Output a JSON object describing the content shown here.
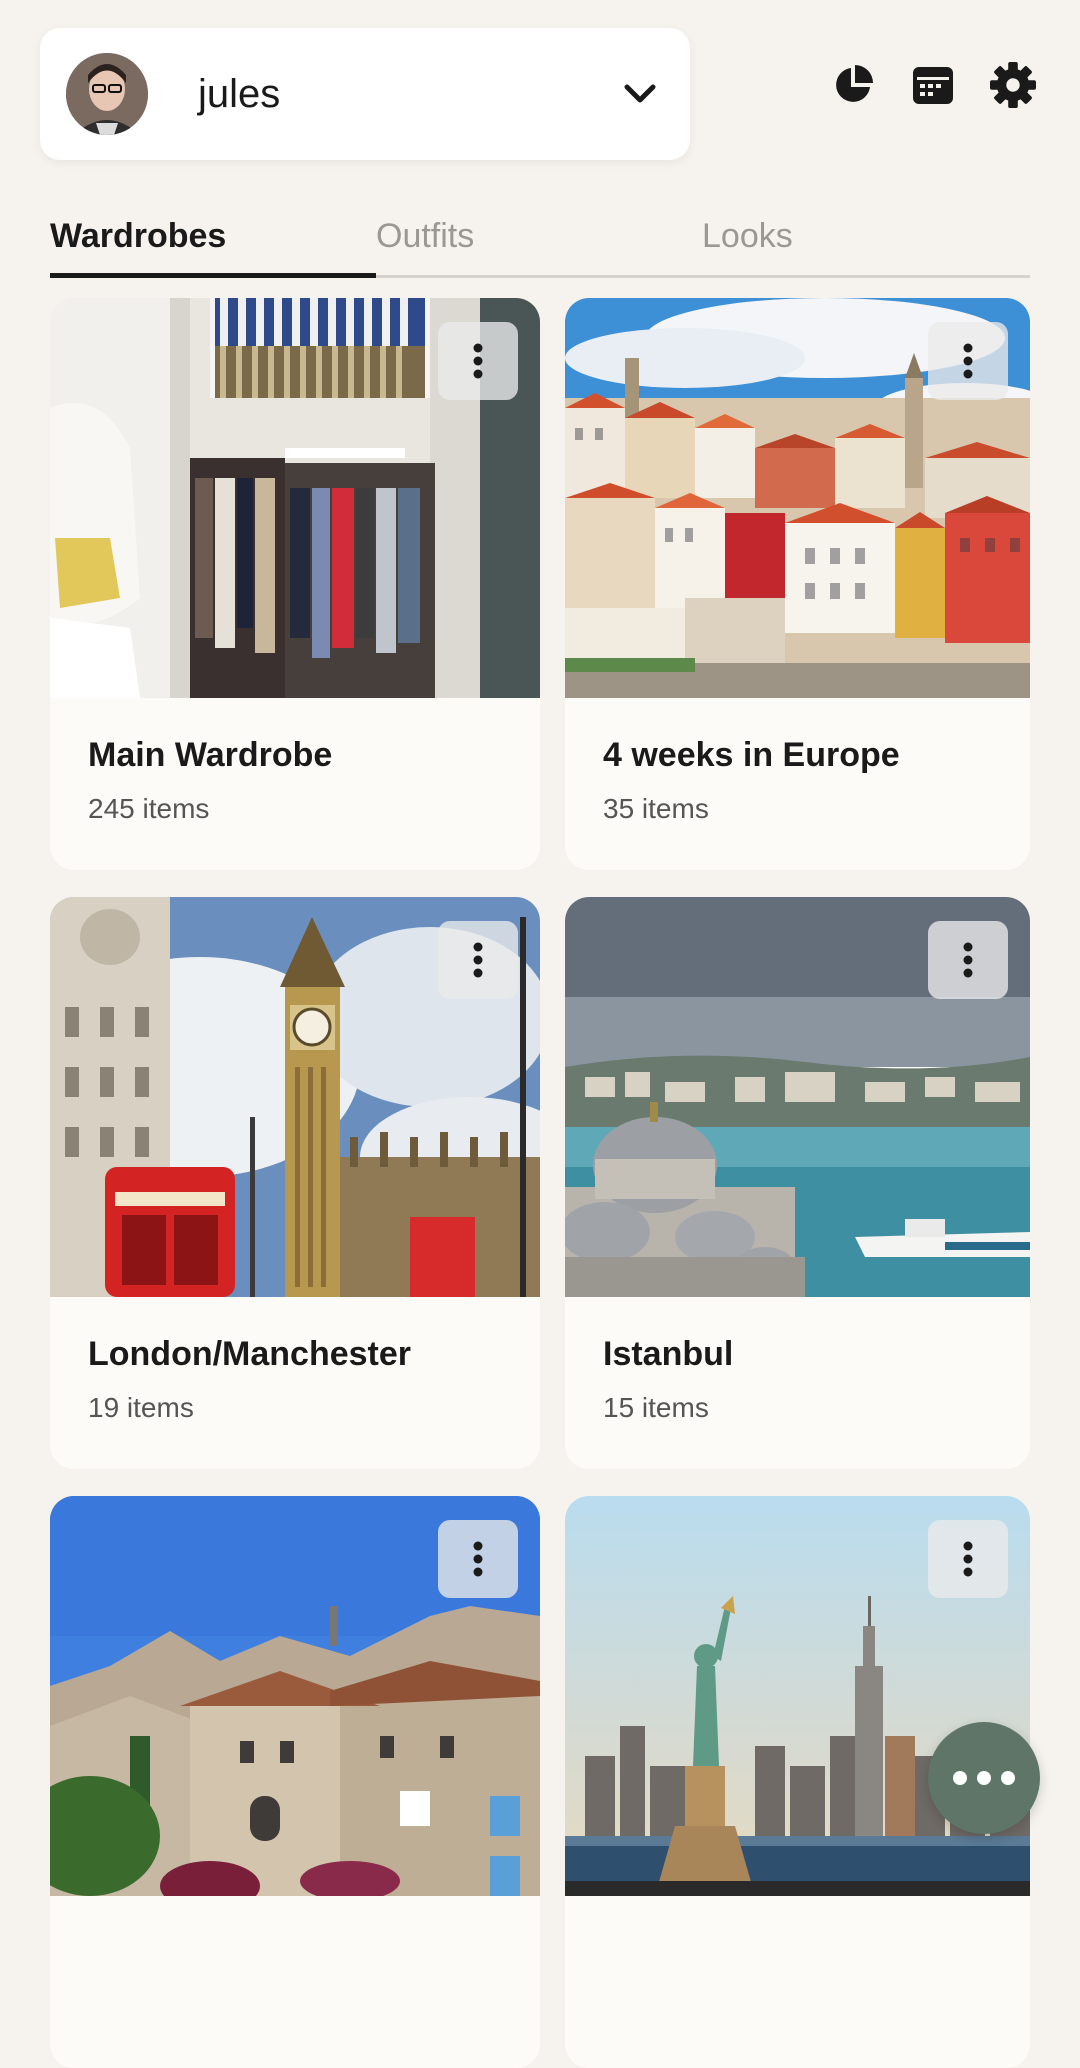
{
  "header": {
    "user_name": "jules",
    "icons": [
      "pie-chart-icon",
      "calendar-icon",
      "gear-icon"
    ]
  },
  "tabs": [
    {
      "label": "Wardrobes",
      "active": true
    },
    {
      "label": "Outfits",
      "active": false
    },
    {
      "label": "Looks",
      "active": false
    }
  ],
  "wardrobes": [
    {
      "title": "Main Wardrobe",
      "count": "245 items"
    },
    {
      "title": "4 weeks in Europe",
      "count": "35 items"
    },
    {
      "title": "London/Manchester",
      "count": "19 items"
    },
    {
      "title": "Istanbul",
      "count": "15 items"
    },
    {
      "title": "",
      "count": ""
    },
    {
      "title": "",
      "count": ""
    }
  ],
  "colors": {
    "background": "#f6f3ee",
    "card": "#fcfbf8",
    "fab": "#5f7568",
    "active_tab": "#1a1a1a",
    "inactive_tab": "#9b9893"
  }
}
